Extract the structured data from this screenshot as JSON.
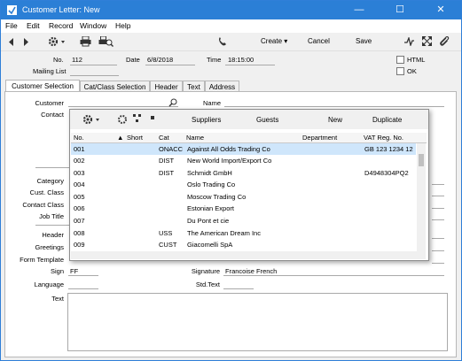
{
  "window": {
    "title": "Customer Letter: New",
    "minimize": "—",
    "maximize": "☐",
    "close": "✕"
  },
  "menu": [
    "File",
    "Edit",
    "Record",
    "Window",
    "Help"
  ],
  "toolbar": {
    "create": "Create",
    "cancel": "Cancel",
    "save": "Save"
  },
  "header": {
    "no_label": "No.",
    "no_value": "112",
    "date_label": "Date",
    "date_value": "6/8/2018",
    "time_label": "Time",
    "time_value": "18:15:00",
    "mailing_label": "Mailing List",
    "html_label": "HTML",
    "ok_label": "OK"
  },
  "tabs": [
    "Customer Selection",
    "Cat/Class Selection",
    "Header",
    "Text",
    "Address"
  ],
  "form": {
    "customer_label": "Customer",
    "contact_label": "Contact",
    "name_label": "Name",
    "category_label": "Category",
    "cust_class_label": "Cust. Class",
    "contact_class_label": "Contact Class",
    "job_title_label": "Job Title",
    "header_label": "Header",
    "greetings_label": "Greetings",
    "form_template_label": "Form Template",
    "sign_label": "Sign",
    "sign_value": "FF",
    "signature_label": "Signature",
    "signature_value": "Francoise French",
    "language_label": "Language",
    "std_text_label": "Std.Text",
    "text_label": "Text"
  },
  "popup": {
    "buttons": {
      "suppliers": "Suppliers",
      "guests": "Guests",
      "new": "New",
      "duplicate": "Duplicate"
    },
    "columns": [
      "No.",
      "Short",
      "Cat",
      "Name",
      "Department",
      "VAT Reg. No."
    ],
    "rows": [
      {
        "no": "001",
        "short": "",
        "cat": "ONACC",
        "name": "Against All Odds Trading Co",
        "dept": "",
        "vat": "GB 123 1234 12"
      },
      {
        "no": "002",
        "short": "",
        "cat": "DIST",
        "name": "New World Import/Export Co",
        "dept": "",
        "vat": ""
      },
      {
        "no": "003",
        "short": "",
        "cat": "DIST",
        "name": "Schmidt GmbH",
        "dept": "",
        "vat": "D4948304PQ2"
      },
      {
        "no": "004",
        "short": "",
        "cat": "",
        "name": "Oslo Trading Co",
        "dept": "",
        "vat": ""
      },
      {
        "no": "005",
        "short": "",
        "cat": "",
        "name": "Moscow Trading Co",
        "dept": "",
        "vat": ""
      },
      {
        "no": "006",
        "short": "",
        "cat": "",
        "name": "Estonian Export",
        "dept": "",
        "vat": ""
      },
      {
        "no": "007",
        "short": "",
        "cat": "",
        "name": "Du Pont et cie",
        "dept": "",
        "vat": ""
      },
      {
        "no": "008",
        "short": "",
        "cat": "USS",
        "name": "The American Dream Inc",
        "dept": "",
        "vat": ""
      },
      {
        "no": "009",
        "short": "",
        "cat": "CUST",
        "name": "Giacomelli SpA",
        "dept": "",
        "vat": ""
      }
    ]
  }
}
